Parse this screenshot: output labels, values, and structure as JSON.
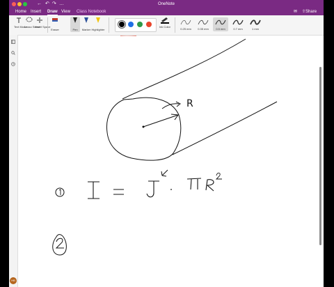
{
  "app": {
    "title": "OneNote"
  },
  "menu": {
    "items": [
      "Home",
      "Insert",
      "Draw",
      "View",
      "Class Notebook"
    ],
    "active": "Draw"
  },
  "share": {
    "label": "Share"
  },
  "ribbon": {
    "tools": [
      {
        "label": "Text Mode",
        "icon": "text-mode-icon"
      },
      {
        "label": "Lasso Select",
        "icon": "lasso-icon"
      },
      {
        "label": "Insert Space",
        "icon": "insert-space-icon"
      },
      {
        "label": "Eraser",
        "icon": "eraser-icon"
      },
      {
        "label": "Pen",
        "icon": "pen-icon"
      },
      {
        "label": "Marker",
        "icon": "marker-icon"
      },
      {
        "label": "Highlighter",
        "icon": "highlighter-icon"
      }
    ],
    "colors": [
      "#000000",
      "#1f6fe5",
      "#2e9a48",
      "#e8452c"
    ],
    "selected_color": "#000000",
    "ink_color_label": "Ink Color",
    "thickness": [
      "0.25 mm",
      "0.35 mm",
      "0.5 mm",
      "0.7 mm",
      "1 mm"
    ],
    "selected_thickness": "0.5 mm"
  },
  "sidebar": {
    "icons": [
      "notebooks-icon",
      "search-icon",
      "recent-icon"
    ],
    "avatar": "HB"
  },
  "ink": {
    "radius_label": "R"
  }
}
